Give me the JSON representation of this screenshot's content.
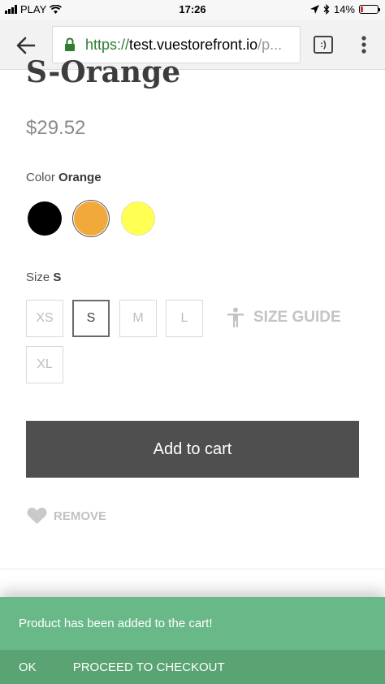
{
  "status_bar": {
    "carrier": "PLAY",
    "time": "17:26",
    "battery": "14%",
    "battery_level": 0.14
  },
  "browser": {
    "url_scheme": "https://",
    "url_host": "test.vuestorefront.io",
    "url_path": "/p...",
    "tabs_label": ":)"
  },
  "product": {
    "title": "S-Orange",
    "price": "$29.52",
    "color_label": "Color",
    "color_value": "Orange",
    "colors": [
      "#000000",
      "#f2a93b",
      "#ffff54"
    ],
    "size_label": "Size",
    "size_value": "S",
    "sizes": [
      "XS",
      "S",
      "M",
      "L",
      "XL"
    ],
    "size_guide": "SIZE GUIDE",
    "add_to_cart": "Add to cart",
    "remove": "REMOVE"
  },
  "toast": {
    "message": "Product has been added to the cart!",
    "ok": "OK",
    "proceed": "PROCEED TO CHECKOUT",
    "color": "#69b887"
  }
}
